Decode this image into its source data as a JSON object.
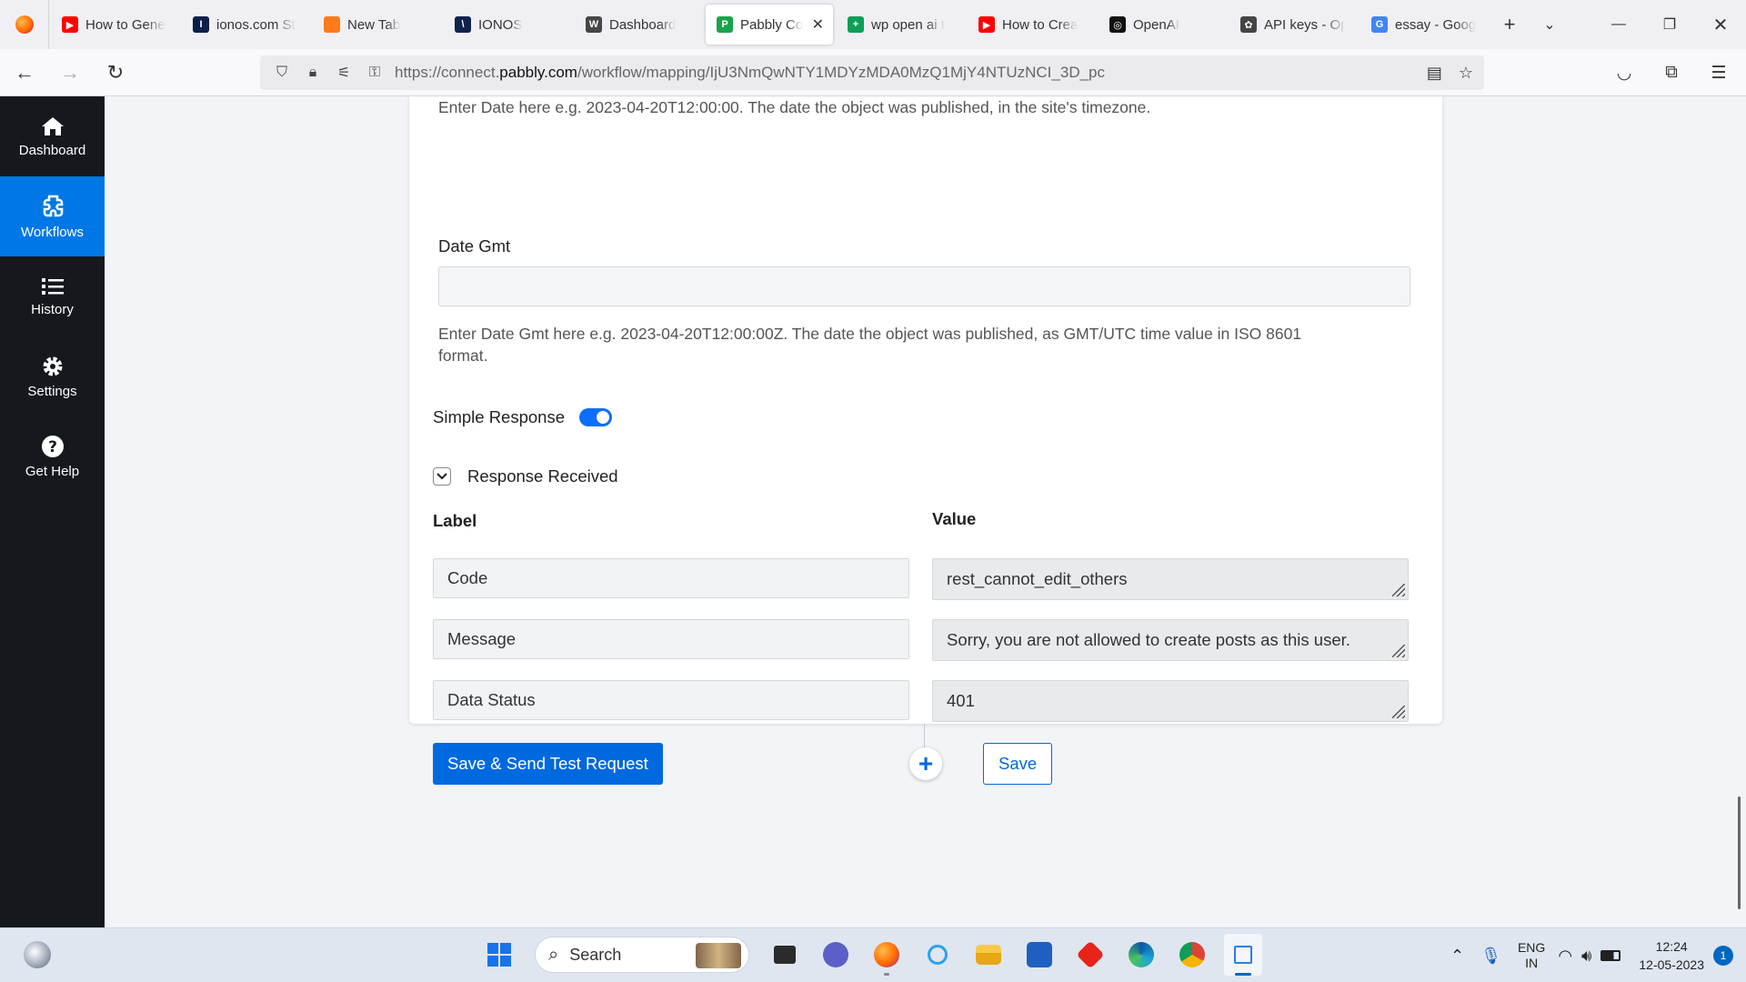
{
  "browser": {
    "tabs": [
      {
        "label": "How to Gene",
        "fav_color": "#ff0000",
        "fav_text": "▶"
      },
      {
        "label": "ionos.com St",
        "fav_color": "#0b1f4b",
        "fav_text": "I"
      },
      {
        "label": "New Tab",
        "fav_color": "#ff7a18",
        "fav_text": ""
      },
      {
        "label": "IONOS",
        "fav_color": "#11224d",
        "fav_text": "\\"
      },
      {
        "label": "Dashboard",
        "fav_color": "#464646",
        "fav_text": "W"
      },
      {
        "label": "Pabbly Co",
        "fav_color": "#1aa34a",
        "fav_text": "P",
        "active": true
      },
      {
        "label": "wp open ai t",
        "fav_color": "#0f9d58",
        "fav_text": "+"
      },
      {
        "label": "How to Crea",
        "fav_color": "#ff0000",
        "fav_text": "▶"
      },
      {
        "label": "OpenAI",
        "fav_color": "#111111",
        "fav_text": "◎"
      },
      {
        "label": "API keys - Op",
        "fav_color": "#444444",
        "fav_text": "✿"
      },
      {
        "label": "essay - Goog",
        "fav_color": "#4285f4",
        "fav_text": "G"
      }
    ],
    "url_prefix": "https://connect.",
    "url_host": "pabbly.com",
    "url_path": "/workflow/mapping/IjU3NmQwNTY1MDYzMDA0MzQ1MjY4NTUzNCI_3D_pc"
  },
  "sidebar": {
    "items": [
      {
        "label": "Dashboard",
        "icon": "home-icon"
      },
      {
        "label": "Workflows",
        "icon": "workflow-icon",
        "active": true
      },
      {
        "label": "History",
        "icon": "list-icon"
      },
      {
        "label": "Settings",
        "icon": "gear-icon"
      },
      {
        "label": "Get Help",
        "icon": "help-icon"
      }
    ]
  },
  "form": {
    "date_help": "Enter Date here e.g. 2023-04-20T12:00:00. The date the object was published, in the site's timezone.",
    "date_gmt_label": "Date Gmt",
    "date_gmt_value": "",
    "date_gmt_help_line1": "Enter Date Gmt here e.g. 2023-04-20T12:00:00Z. The date the object was published, as GMT/UTC time value in ISO 8601",
    "date_gmt_help_line2": "format.",
    "simple_response_label": "Simple Response",
    "response_received_label": "Response Received",
    "label_header": "Label",
    "value_header": "Value",
    "rows": [
      {
        "label": "Code",
        "value": "rest_cannot_edit_others"
      },
      {
        "label": "Message",
        "value": "Sorry, you are not allowed to create posts as this user."
      },
      {
        "label": "Data Status",
        "value": "401"
      }
    ],
    "save_send_label": "Save & Send Test Request",
    "save_label": "Save",
    "add_step_symbol": "+"
  },
  "taskbar": {
    "search_label": "Search",
    "lang_line1": "ENG",
    "lang_line2": "IN",
    "time": "12:24",
    "date": "12-05-2023",
    "notification_count": "1"
  }
}
